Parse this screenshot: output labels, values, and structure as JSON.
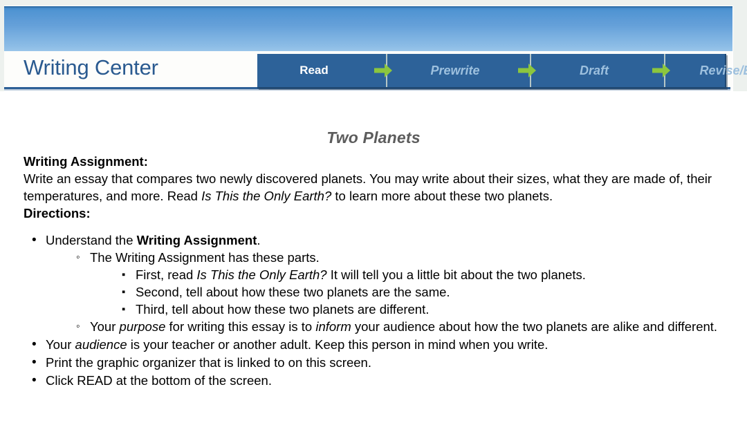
{
  "header": {
    "brand": "Writing Center",
    "tabs": [
      {
        "label": "Read",
        "state": "active"
      },
      {
        "label": "Prewrite",
        "state": "inactive"
      },
      {
        "label": "Draft",
        "state": "inactive"
      },
      {
        "label": "Revise/Edit",
        "state": "inactive"
      }
    ],
    "separator_icon": "green-right-arrow-icon"
  },
  "colors": {
    "banner_top": "#2a79c0",
    "banner_bottom": "#9cc6ea",
    "nav_panel": "#2d6299",
    "nav_active_text": "#ffffff",
    "nav_inactive_text": "#9dc0de",
    "arrow_green": "#8cc63e",
    "brand_blue": "#2a5a90",
    "title_gray": "#5c5c5c"
  },
  "document": {
    "title": "Two Planets",
    "assignment_label": "Writing Assignment:",
    "assignment_text_1": "Write an essay that compares two newly discovered planets. You may write about their sizes, what they are made of, their temperatures, and more. Read ",
    "assignment_italic": "Is This the Only Earth?",
    "assignment_text_2": " to learn more about these two planets.",
    "directions_label": "Directions:",
    "bullets": {
      "b1_a": "Understand the ",
      "b1_bold": "Writing Assignment",
      "b1_b": ".",
      "b1_sub1": "The Writing Assignment has these parts.",
      "b1_sub1_items": {
        "i1_a": "First, read ",
        "i1_italic": "Is This the Only Earth?",
        "i1_b": " It will tell you a little bit about the two planets.",
        "i2": "Second, tell about how these two planets are the same.",
        "i3": "Third, tell about how these two planets are different."
      },
      "b1_sub2_a": "Your ",
      "b1_sub2_it1": "purpose",
      "b1_sub2_b": " for writing this essay is to ",
      "b1_sub2_it2": "inform",
      "b1_sub2_c": " your audience about how the two planets are alike and different.",
      "b2_a": "Your ",
      "b2_it": "audience",
      "b2_b": " is your teacher or another adult. Keep this person in mind when you write.",
      "b3": "Print the graphic organizer that is linked to on this screen.",
      "b4": "Click READ at the bottom of the screen."
    }
  }
}
